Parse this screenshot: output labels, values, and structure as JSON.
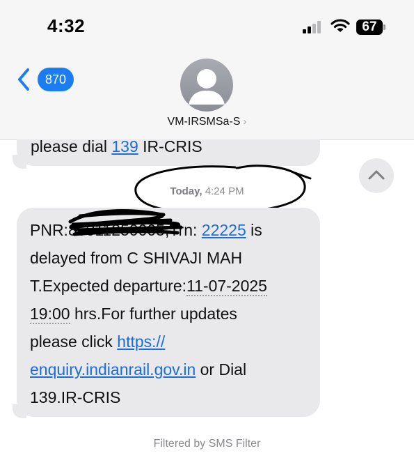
{
  "status_bar": {
    "time": "4:32",
    "battery_level": "67",
    "icons": [
      "cellular-signal-icon",
      "wifi-icon",
      "battery-icon"
    ]
  },
  "header": {
    "back_icon": "chevron-left-icon",
    "unread_count": "870",
    "avatar_icon": "person-avatar-icon",
    "contact_name": "VM-IRSMSa-S",
    "contact_chevron": "›"
  },
  "previous_message": {
    "text_before": "please dial ",
    "phone_link": "139",
    "text_after": " IR-CRIS"
  },
  "timestamp": {
    "day": "Today,",
    "time": "4:24 PM"
  },
  "message": {
    "pnr_label": "PNR:",
    "pnr_redacted": "86011250005",
    "trn_label": ",Trn: ",
    "train_number": "22225",
    "line1_tail": " is",
    "line2": "delayed from C SHIVAJI MAH",
    "line3_start": "T.Expected departure:",
    "date": "11-07-2025",
    "time_value": "19:00",
    "line4_tail": " hrs.For further updates",
    "line5_start": "please click ",
    "link_part1": "https://",
    "link_part2": "enquiry.indianrail.gov.in",
    "line6_tail": " or Dial",
    "line7": "139.IR-CRIS"
  },
  "scroll_button_icon": "chevron-up-icon",
  "footer": {
    "filter_note": "Filtered by SMS Filter"
  },
  "colors": {
    "accent_blue": "#1c7cf2",
    "bubble_gray": "#e9e9eb",
    "link_blue": "#1a6ddb"
  }
}
